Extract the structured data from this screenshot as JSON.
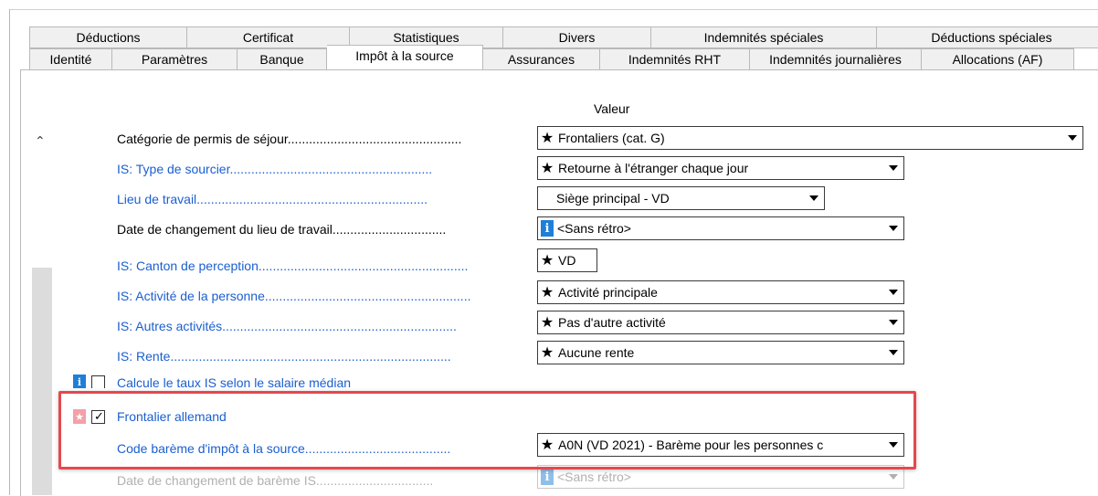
{
  "tabs_row1": [
    {
      "label": "Déductions",
      "w": 173
    },
    {
      "label": "Certificat",
      "w": 178
    },
    {
      "label": "Statistiques",
      "w": 168
    },
    {
      "label": "Divers",
      "w": 162
    },
    {
      "label": "Indemnités spéciales",
      "w": 247
    },
    {
      "label": "Déductions spéciales",
      "w": 252
    }
  ],
  "tabs_row2": [
    {
      "label": "Identité",
      "w": 91
    },
    {
      "label": "Paramètres",
      "w": 137
    },
    {
      "label": "Banque",
      "w": 98
    },
    {
      "label": "Impôt à la source",
      "w": 171,
      "active": true
    },
    {
      "label": "Assurances",
      "w": 128
    },
    {
      "label": "Indemnités RHT",
      "w": 164
    },
    {
      "label": "Indemnités journalières",
      "w": 188
    },
    {
      "label": "Allocations (AF)",
      "w": 167
    }
  ],
  "header": {
    "valeur": "Valeur"
  },
  "fields": {
    "permis": {
      "label": "Catégorie de permis de séjour",
      "value": "Frontaliers (cat. G)"
    },
    "type_sourcier": {
      "label": "IS: Type de sourcier",
      "value": "Retourne à l'étranger chaque jour"
    },
    "lieu_travail": {
      "label": "Lieu de travail",
      "value": "Siège principal - VD"
    },
    "date_changement_lieu": {
      "label": "Date de changement du lieu de travail",
      "value": "<Sans rétro>"
    },
    "canton": {
      "label": "IS: Canton de perception",
      "value": "VD"
    },
    "activite": {
      "label": "IS: Activité de la personne",
      "value": "Activité principale"
    },
    "autres_activites": {
      "label": "IS: Autres activités",
      "value": "Pas d'autre activité"
    },
    "rente": {
      "label": "IS: Rente",
      "value": "Aucune rente"
    },
    "salaire_median": {
      "label": "Calcule le taux IS selon le salaire médian"
    },
    "frontalier_allemand": {
      "label": "Frontalier allemand"
    },
    "code_bareme": {
      "label": "Code barème d'impôt à la source",
      "value": "A0N (VD 2021) - Barème pour les personnes c"
    },
    "date_changement_bareme": {
      "label": "Date de changement de barème IS",
      "value": "<Sans rétro>"
    }
  },
  "icons": {
    "star": "asterisk",
    "info": "info-icon"
  },
  "colors": {
    "link_blue": "#1a5fd0",
    "highlight_red": "#e5484d",
    "info_blue": "#1e7fd8"
  }
}
